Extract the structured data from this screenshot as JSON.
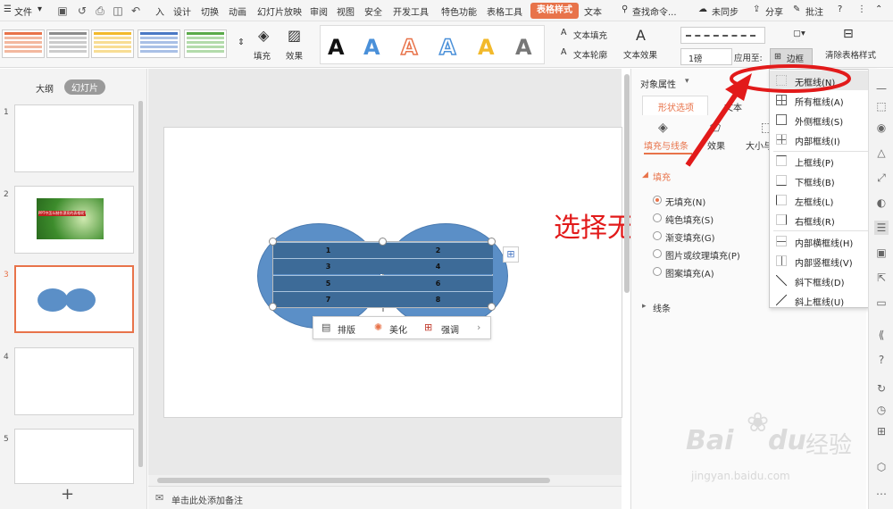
{
  "menubar": {
    "file": "文件",
    "tabs": [
      "入",
      "设计",
      "切换",
      "动画",
      "幻灯片放映",
      "审阅",
      "视图",
      "安全",
      "开发工具",
      "特色功能",
      "表格工具",
      "表格样式",
      "文本"
    ],
    "search": "查找命令...",
    "sync": "未同步",
    "share": "分享",
    "comment": "批注"
  },
  "ribbon": {
    "fill": "填充",
    "effect": "效果",
    "text_fill": "文本填充",
    "text_outline": "文本轮廓",
    "text_effect": "文本效果",
    "pen_weight": "1磅",
    "apply_to": "应用至:",
    "border": "边框",
    "clear_style": "清除表格样式",
    "swatch_colors": [
      "#e8734a",
      "#8c8c8c",
      "#f2b92b",
      "#4a78c4",
      "#5aaa4a"
    ],
    "wordart_colors": [
      "#111111",
      "#4a90d9",
      "#e8734a",
      "#4a90d9",
      "#f2b92b",
      "#777777"
    ]
  },
  "left_panel": {
    "tabs": [
      "大纲",
      "幻灯片"
    ],
    "slides": [
      "1",
      "2",
      "3",
      "4",
      "5"
    ],
    "slide2_text": "PPT中怎么制作漂亮的表格呢?",
    "add": "+"
  },
  "table": {
    "cells": [
      "1",
      "2",
      "3",
      "4",
      "5",
      "6",
      "7",
      "8"
    ]
  },
  "float_toolbar": {
    "layout": "排版",
    "beautify": "美化",
    "emphasize": "强调"
  },
  "annotation": "选择无框线",
  "notes": "单击此处添加备注",
  "props": {
    "title": "对象属性",
    "tab_shape": "形状选项",
    "tab_text": "文本",
    "sub_fill_line": "填充与线条",
    "sub_effect": "效果",
    "sub_size": "大小与",
    "section_fill": "填充",
    "opts": [
      "无填充(N)",
      "纯色填充(S)",
      "渐变填充(G)",
      "图片或纹理填充(P)",
      "图案填充(A)"
    ],
    "section_line": "线条"
  },
  "dropdown": {
    "items": [
      "无框线(N)",
      "所有框线(A)",
      "外侧框线(S)",
      "内部框线(I)",
      "上框线(P)",
      "下框线(B)",
      "左框线(L)",
      "右框线(R)",
      "内部横框线(H)",
      "内部竖框线(V)",
      "斜下框线(D)",
      "斜上框线(U)"
    ]
  },
  "watermark": {
    "brand": "Bai",
    "brand2": "du",
    "cn": "经验",
    "url": "jingyan.baidu.com"
  },
  "colors": {
    "accent": "#e8734a",
    "annotation_red": "#e21a1a",
    "ellipse_blue": "#5b8fc7",
    "table_blue": "#3d6b98"
  }
}
